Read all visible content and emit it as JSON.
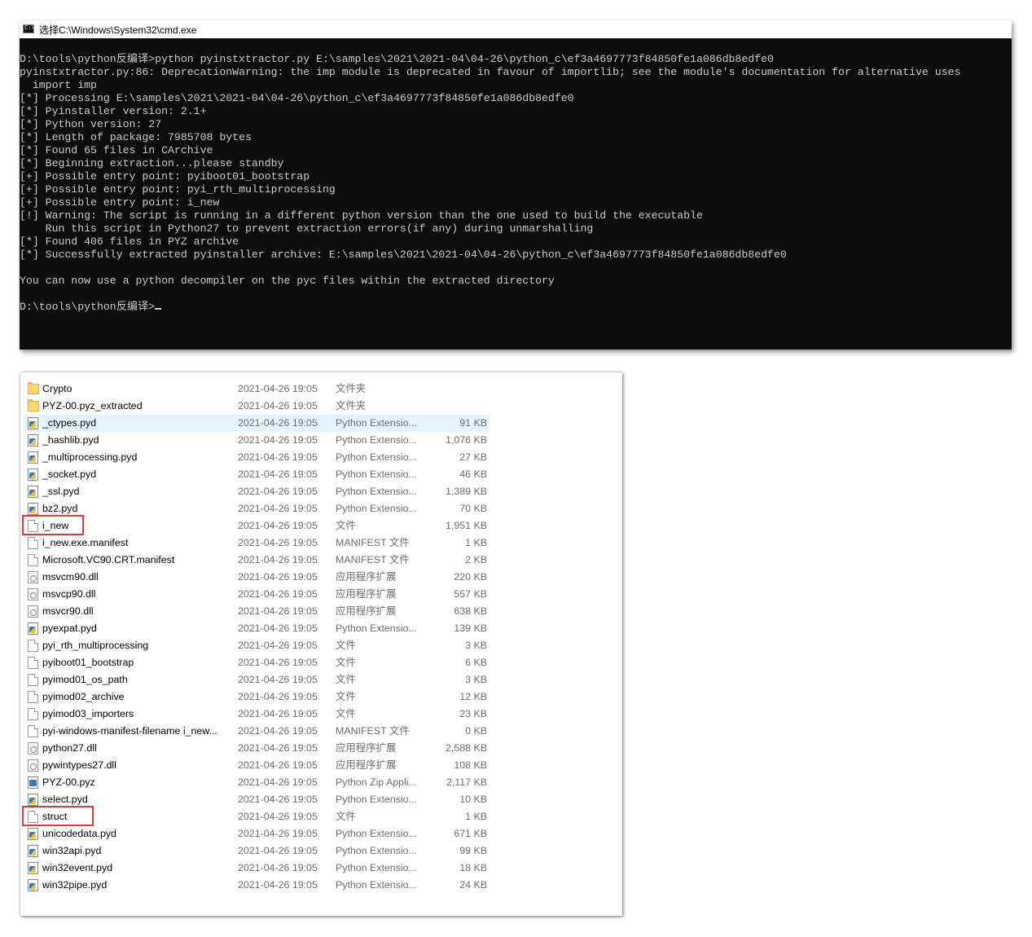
{
  "cmd": {
    "title": "选择C:\\Windows\\System32\\cmd.exe",
    "lines": [
      "D:\\tools\\python反编译>python pyinstxtractor.py E:\\samples\\2021\\2021-04\\04-26\\python_c\\ef3a4697773f84850fe1a086db8edfe0",
      "pyinstxtractor.py:86: DeprecationWarning: the imp module is deprecated in favour of importlib; see the module's documentation for alternative uses",
      "  import imp",
      "[*] Processing E:\\samples\\2021\\2021-04\\04-26\\python_c\\ef3a4697773f84850fe1a086db8edfe0",
      "[*] Pyinstaller version: 2.1+",
      "[*] Python version: 27",
      "[*] Length of package: 7985708 bytes",
      "[*] Found 65 files in CArchive",
      "[*] Beginning extraction...please standby",
      "[+] Possible entry point: pyiboot01_bootstrap",
      "[+] Possible entry point: pyi_rth_multiprocessing",
      "[+] Possible entry point: i_new",
      "[!] Warning: The script is running in a different python version than the one used to build the executable",
      "    Run this script in Python27 to prevent extraction errors(if any) during unmarshalling",
      "[*] Found 406 files in PYZ archive",
      "[*] Successfully extracted pyinstaller archive: E:\\samples\\2021\\2021-04\\04-26\\python_c\\ef3a4697773f84850fe1a086db8edfe0",
      "",
      "You can now use a python decompiler on the pyc files within the extracted directory",
      "",
      "D:\\tools\\python反编译>"
    ]
  },
  "explorer": {
    "files": [
      {
        "name": "Crypto",
        "date": "2021-04-26 19:05",
        "type": "文件夹",
        "size": "",
        "icon": "folder-icon"
      },
      {
        "name": "PYZ-00.pyz_extracted",
        "date": "2021-04-26 19:05",
        "type": "文件夹",
        "size": "",
        "icon": "folder-icon"
      },
      {
        "name": "_ctypes.pyd",
        "date": "2021-04-26 19:05",
        "type": "Python Extensio...",
        "size": "91 KB",
        "icon": "python-extension-icon",
        "selected": true
      },
      {
        "name": "_hashlib.pyd",
        "date": "2021-04-26 19:05",
        "type": "Python Extensio...",
        "size": "1,076 KB",
        "icon": "python-extension-icon"
      },
      {
        "name": "_multiprocessing.pyd",
        "date": "2021-04-26 19:05",
        "type": "Python Extensio...",
        "size": "27 KB",
        "icon": "python-extension-icon"
      },
      {
        "name": "_socket.pyd",
        "date": "2021-04-26 19:05",
        "type": "Python Extensio...",
        "size": "46 KB",
        "icon": "python-extension-icon"
      },
      {
        "name": "_ssl.pyd",
        "date": "2021-04-26 19:05",
        "type": "Python Extensio...",
        "size": "1,389 KB",
        "icon": "python-extension-icon"
      },
      {
        "name": "bz2.pyd",
        "date": "2021-04-26 19:05",
        "type": "Python Extensio...",
        "size": "70 KB",
        "icon": "python-extension-icon"
      },
      {
        "name": "i_new",
        "date": "2021-04-26 19:05",
        "type": "文件",
        "size": "1,951 KB",
        "icon": "file-icon",
        "highlighted": true
      },
      {
        "name": "i_new.exe.manifest",
        "date": "2021-04-26 19:05",
        "type": "MANIFEST 文件",
        "size": "1 KB",
        "icon": "file-icon"
      },
      {
        "name": "Microsoft.VC90.CRT.manifest",
        "date": "2021-04-26 19:05",
        "type": "MANIFEST 文件",
        "size": "2 KB",
        "icon": "file-icon"
      },
      {
        "name": "msvcm90.dll",
        "date": "2021-04-26 19:05",
        "type": "应用程序扩展",
        "size": "220 KB",
        "icon": "dll-icon"
      },
      {
        "name": "msvcp90.dll",
        "date": "2021-04-26 19:05",
        "type": "应用程序扩展",
        "size": "557 KB",
        "icon": "dll-icon"
      },
      {
        "name": "msvcr90.dll",
        "date": "2021-04-26 19:05",
        "type": "应用程序扩展",
        "size": "638 KB",
        "icon": "dll-icon"
      },
      {
        "name": "pyexpat.pyd",
        "date": "2021-04-26 19:05",
        "type": "Python Extensio...",
        "size": "139 KB",
        "icon": "python-extension-icon"
      },
      {
        "name": "pyi_rth_multiprocessing",
        "date": "2021-04-26 19:05",
        "type": "文件",
        "size": "3 KB",
        "icon": "file-icon"
      },
      {
        "name": "pyiboot01_bootstrap",
        "date": "2021-04-26 19:05",
        "type": "文件",
        "size": "6 KB",
        "icon": "file-icon"
      },
      {
        "name": "pyimod01_os_path",
        "date": "2021-04-26 19:05",
        "type": "文件",
        "size": "3 KB",
        "icon": "file-icon"
      },
      {
        "name": "pyimod02_archive",
        "date": "2021-04-26 19:05",
        "type": "文件",
        "size": "12 KB",
        "icon": "file-icon"
      },
      {
        "name": "pyimod03_importers",
        "date": "2021-04-26 19:05",
        "type": "文件",
        "size": "23 KB",
        "icon": "file-icon"
      },
      {
        "name": "pyi-windows-manifest-filename i_new...",
        "date": "2021-04-26 19:05",
        "type": "MANIFEST 文件",
        "size": "0 KB",
        "icon": "file-icon"
      },
      {
        "name": "python27.dll",
        "date": "2021-04-26 19:05",
        "type": "应用程序扩展",
        "size": "2,588 KB",
        "icon": "dll-icon"
      },
      {
        "name": "pywintypes27.dll",
        "date": "2021-04-26 19:05",
        "type": "应用程序扩展",
        "size": "108 KB",
        "icon": "dll-icon"
      },
      {
        "name": "PYZ-00.pyz",
        "date": "2021-04-26 19:05",
        "type": "Python Zip Appli...",
        "size": "2,117 KB",
        "icon": "python-zip-icon"
      },
      {
        "name": "select.pyd",
        "date": "2021-04-26 19:05",
        "type": "Python Extensio...",
        "size": "10 KB",
        "icon": "python-extension-icon"
      },
      {
        "name": "struct",
        "date": "2021-04-26 19:05",
        "type": "文件",
        "size": "1 KB",
        "icon": "file-icon",
        "highlighted": true
      },
      {
        "name": "unicodedata.pyd",
        "date": "2021-04-26 19:05",
        "type": "Python Extensio...",
        "size": "671 KB",
        "icon": "python-extension-icon"
      },
      {
        "name": "win32api.pyd",
        "date": "2021-04-26 19:05",
        "type": "Python Extensio...",
        "size": "99 KB",
        "icon": "python-extension-icon"
      },
      {
        "name": "win32event.pyd",
        "date": "2021-04-26 19:05",
        "type": "Python Extensio...",
        "size": "18 KB",
        "icon": "python-extension-icon"
      },
      {
        "name": "win32pipe.pyd",
        "date": "2021-04-26 19:05",
        "type": "Python Extensio...",
        "size": "24 KB",
        "icon": "python-extension-icon"
      }
    ]
  },
  "colors": {
    "terminal_bg": "#0c0c0c",
    "terminal_text": "#cccccc",
    "selection_bg": "#e5f3ff",
    "annotation_red": "#e23a3a"
  }
}
